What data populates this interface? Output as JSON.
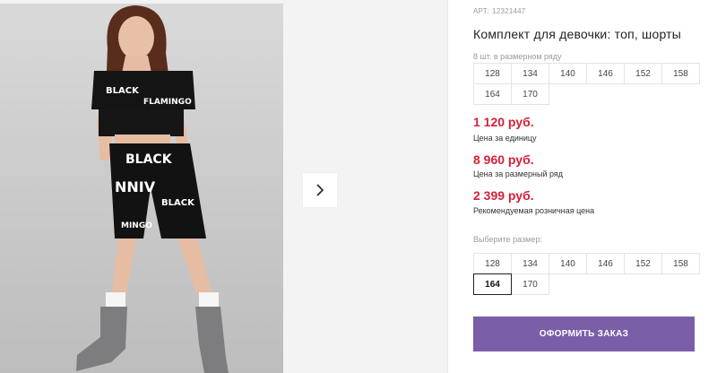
{
  "product": {
    "article_label": "АРТ:",
    "article": "12321447",
    "title": "Комплект для девочки: топ, шорты"
  },
  "size_row": {
    "caption": "8 шт. в размерном ряду",
    "sizes": [
      "128",
      "134",
      "140",
      "146",
      "152",
      "158",
      "164",
      "170"
    ]
  },
  "prices": {
    "unit_price": "1 120 руб.",
    "unit_label": "Цена за единицу",
    "row_price": "8 960 руб.",
    "row_label": "Цена за размерный ряд",
    "retail_price": "2 399 руб.",
    "retail_label": "Рекомендуемая розничная цена"
  },
  "size_select": {
    "caption": "Выберите размер:",
    "sizes": [
      "128",
      "134",
      "140",
      "146",
      "152",
      "158",
      "164",
      "170"
    ],
    "selected": "164"
  },
  "order_button": "ОФОРМИТЬ ЗАКАЗ",
  "icons": {
    "next": "chevron-right-icon"
  },
  "colors": {
    "accent": "#7a5ea8",
    "price": "#d81e36"
  }
}
